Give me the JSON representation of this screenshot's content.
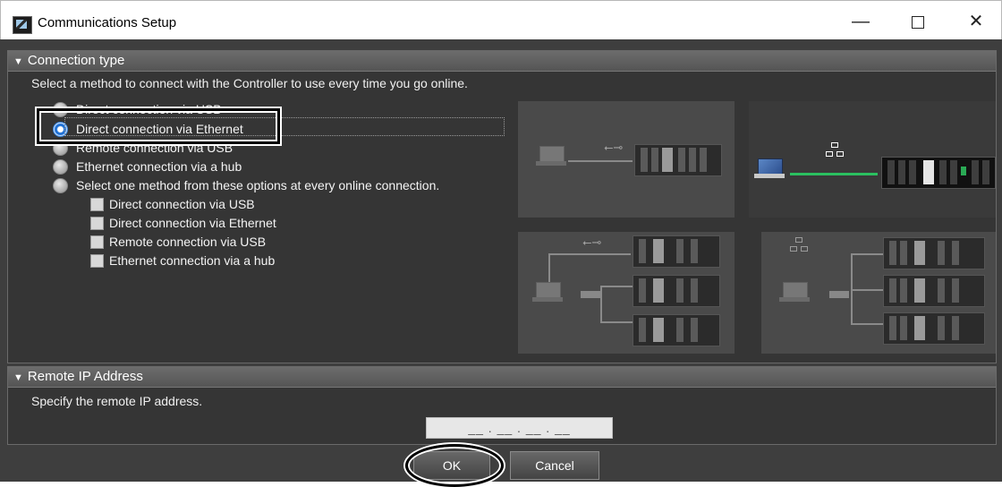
{
  "window": {
    "title": "Communications Setup",
    "minimize_glyph": "—",
    "close_glyph": "✕"
  },
  "connection_section": {
    "header": "Connection type",
    "instruction": "Select a method to connect with the Controller to use every time you go online.",
    "options": [
      {
        "label": "Direct connection via USB",
        "selected": false
      },
      {
        "label": "Direct connection via Ethernet",
        "selected": true
      },
      {
        "label": "Remote connection via USB",
        "selected": false
      },
      {
        "label": "Ethernet connection via a hub",
        "selected": false
      },
      {
        "label": "Select one method from these options at every online connection.",
        "selected": false
      }
    ],
    "sub_options": [
      {
        "label": "Direct connection via USB",
        "checked": false
      },
      {
        "label": "Direct connection via Ethernet",
        "checked": false
      },
      {
        "label": "Remote connection via USB",
        "checked": false
      },
      {
        "label": "Ethernet connection via a hub",
        "checked": false
      }
    ]
  },
  "remote_ip_section": {
    "header": "Remote IP Address",
    "instruction": "Specify the remote IP address.",
    "ip_display": "__ . __ . __ . __"
  },
  "buttons": {
    "ok": "OK",
    "cancel": "Cancel"
  },
  "colors": {
    "dialog_bg": "#3e3e3e",
    "selected_radio": "#1d6fd4",
    "active_link": "#2bc060"
  },
  "icons": [
    "app-icon",
    "collapse-triangle-icon",
    "usb-icon",
    "network-icon",
    "laptop-icon",
    "controller-icon",
    "hub-icon"
  ]
}
